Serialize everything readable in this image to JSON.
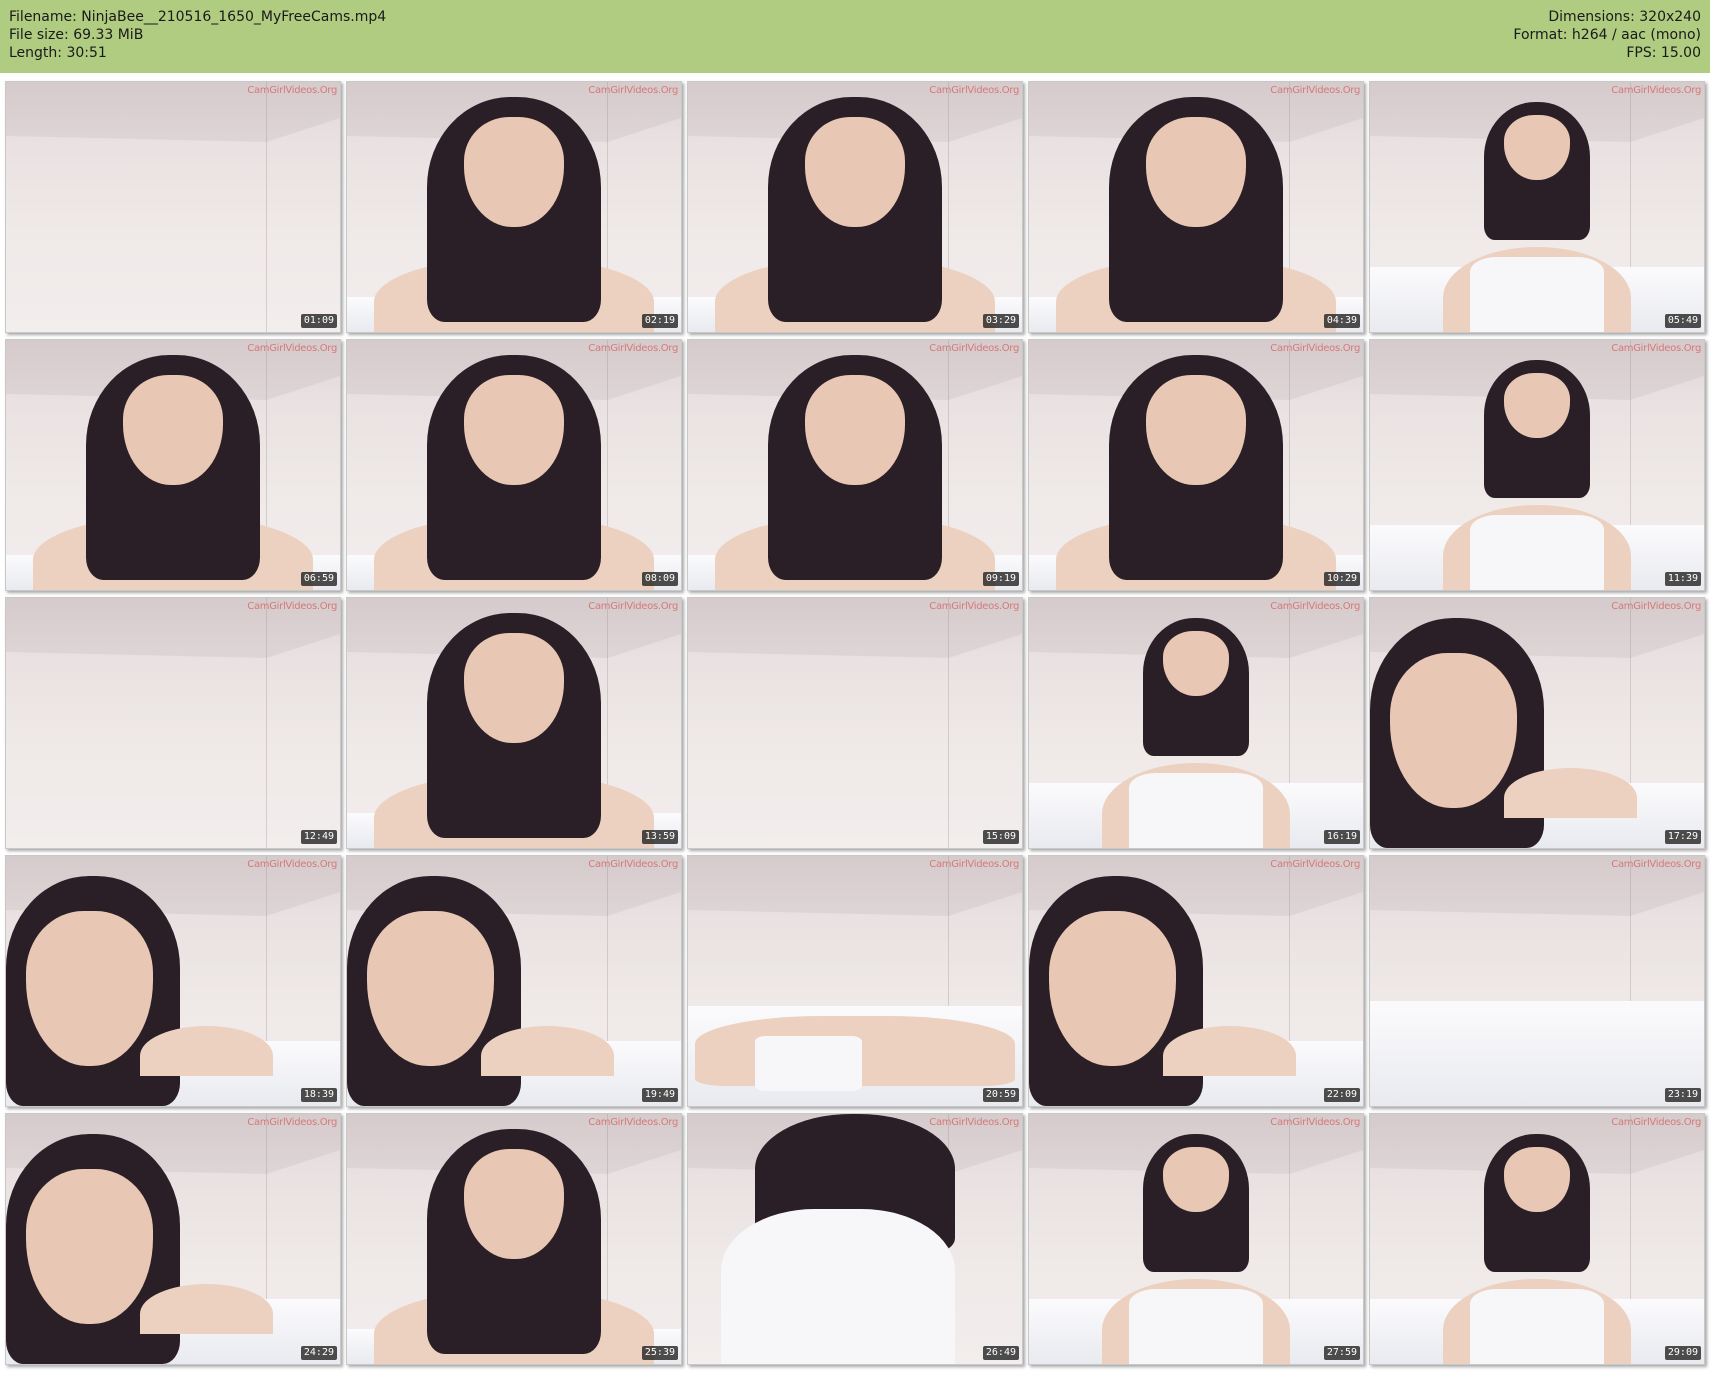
{
  "header": {
    "filename_label": "Filename: NinjaBee__210516_1650_MyFreeCams.mp4",
    "filesize_label": "File size: 69.33 MiB",
    "length_label": "Length: 30:51",
    "dimensions_label": "Dimensions: 320x240",
    "format_label": "Format: h264 / aac (mono)",
    "fps_label": "FPS: 15.00",
    "background_color": "#b0cc80"
  },
  "watermark_text": "CamGirlVideos.Org",
  "thumbnails": [
    {
      "timestamp": "01:09",
      "scene": "empty-wall"
    },
    {
      "timestamp": "02:19",
      "scene": "close-up"
    },
    {
      "timestamp": "03:29",
      "scene": "close-up"
    },
    {
      "timestamp": "04:39",
      "scene": "close-up"
    },
    {
      "timestamp": "05:49",
      "scene": "sitting-white-top"
    },
    {
      "timestamp": "06:59",
      "scene": "close-up"
    },
    {
      "timestamp": "08:09",
      "scene": "close-up"
    },
    {
      "timestamp": "09:19",
      "scene": "close-up"
    },
    {
      "timestamp": "10:29",
      "scene": "close-up"
    },
    {
      "timestamp": "11:39",
      "scene": "sitting-white-top"
    },
    {
      "timestamp": "12:49",
      "scene": "empty-wall"
    },
    {
      "timestamp": "13:59",
      "scene": "close-up"
    },
    {
      "timestamp": "15:09",
      "scene": "empty-wall"
    },
    {
      "timestamp": "16:19",
      "scene": "sitting-white-top"
    },
    {
      "timestamp": "17:29",
      "scene": "lying-close"
    },
    {
      "timestamp": "18:39",
      "scene": "lying-close"
    },
    {
      "timestamp": "19:49",
      "scene": "lying-close"
    },
    {
      "timestamp": "20:59",
      "scene": "lying-back"
    },
    {
      "timestamp": "22:09",
      "scene": "lying-close"
    },
    {
      "timestamp": "23:19",
      "scene": "empty-bed"
    },
    {
      "timestamp": "24:29",
      "scene": "lying-close"
    },
    {
      "timestamp": "25:39",
      "scene": "close-up"
    },
    {
      "timestamp": "26:49",
      "scene": "towel"
    },
    {
      "timestamp": "27:59",
      "scene": "sitting-white-top"
    },
    {
      "timestamp": "29:09",
      "scene": "sitting-white-top"
    }
  ]
}
